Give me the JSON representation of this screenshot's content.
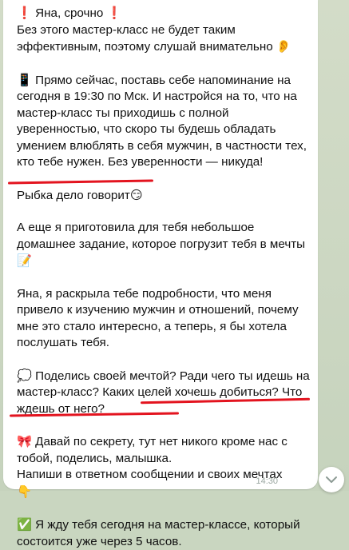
{
  "message": {
    "p1_title": "Яна, срочно",
    "p1_body": "Без этого мастер-класс не будет таким эффективным, поэтому слушай внимательно",
    "p2_body": "Прямо сейчас, поставь себе напоминание на сегодня в 19:30 по Мск. И настройся на то, что на мастер-класс ты приходишь с полной уверенностью, что скоро ты будешь обладать умением влюблять в себя мужчин, в частности тех, кто тебе нужен. Без уверенности — никуда!",
    "p3_body": "Рыбка дело говорит",
    "p4_body": "А еще я приготовила для тебя небольшое домашнее задание, которое погрузит тебя в мечты",
    "p5_body": "Яна, я раскрыла тебе подробности, что меня привело к изучению мужчин и отношений, почему мне это стало интересно, а теперь, я бы хотела послушать тебя.",
    "p6_body": "Поделись своей мечтой? Ради чего ты идешь на мастер-класс? Каких целей хочешь добиться? Что ждешь от него?",
    "p7_lead": "Давай по секрету,",
    "p7_highlight": "тут нет никого кроме нас с тобой, поделись, малышка.",
    "p7_tail": "Напиши в ответном сообщении и своих мечтах",
    "p8_body": "Я жду тебя сегодня на мастер-классе, который состоится уже через 5 часов.",
    "time": "14:30"
  },
  "icons": {
    "exclamation": "❗",
    "phone": "📱",
    "smirk": "😏",
    "ear": "👂",
    "memo": "📝",
    "speech": "💭",
    "ribbon": "🎀",
    "point_down": "👇",
    "check": "✅"
  },
  "colors": {
    "highlight_underline": "#e3141f",
    "bubble": "#ffffff",
    "chat_background": "#c9d6c0"
  }
}
